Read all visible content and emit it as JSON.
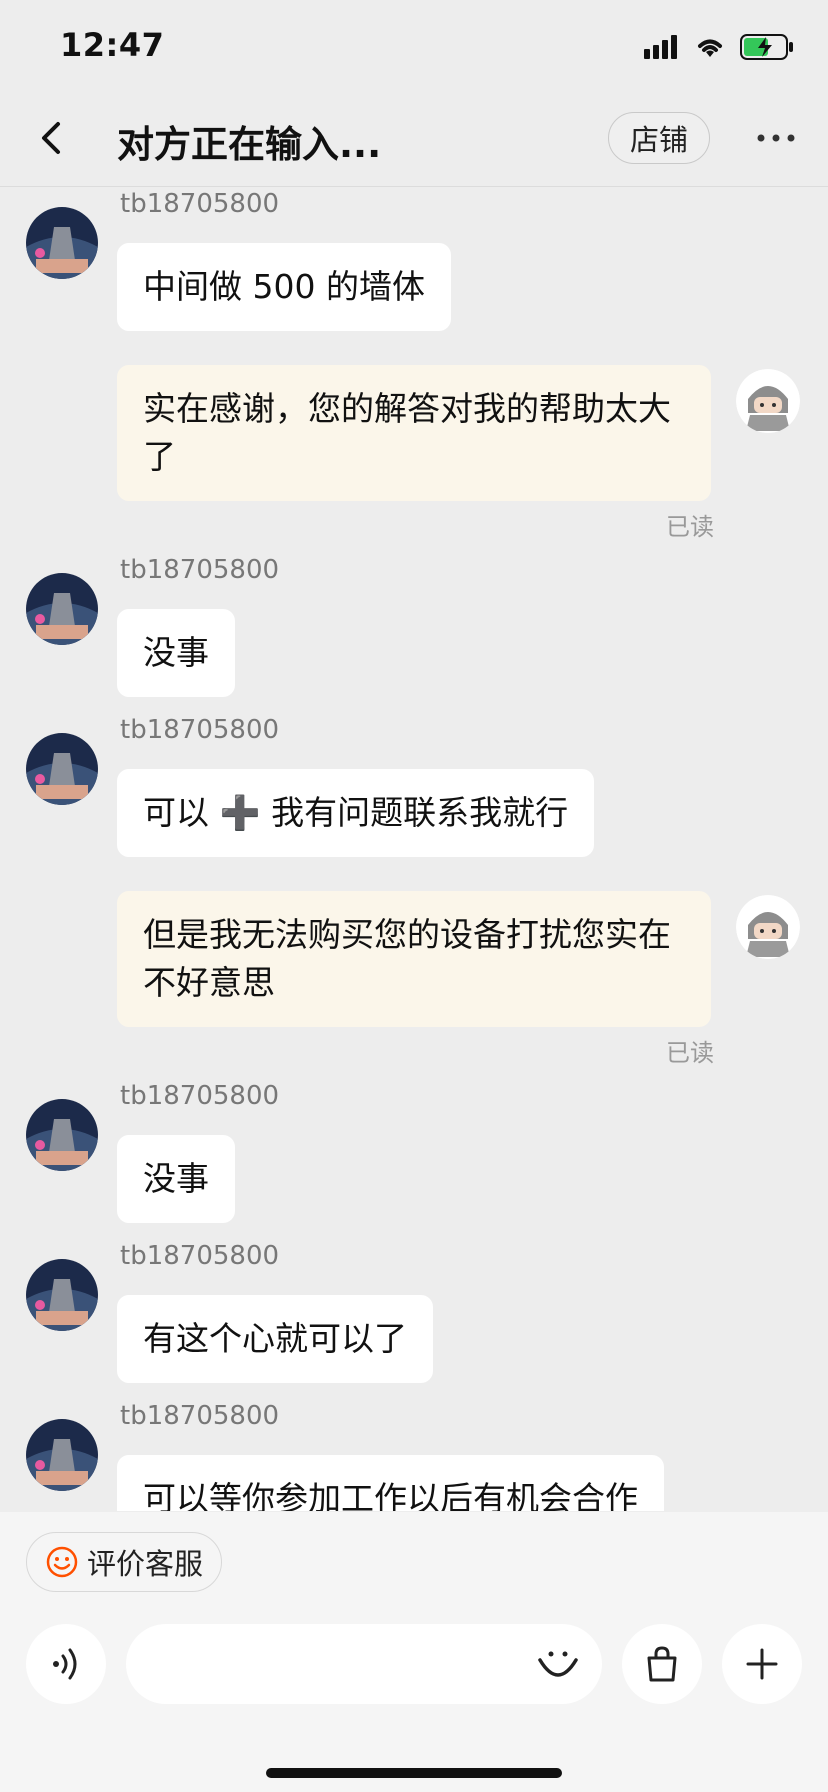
{
  "status_bar": {
    "time": "12:47"
  },
  "header": {
    "title": "对方正在输入...",
    "store_label": "店铺"
  },
  "messages": [
    {
      "side": "left",
      "sender": "tb18705800",
      "text": "中间做 500 的墙体"
    },
    {
      "side": "right",
      "text": "实在感谢，您的解答对我的帮助太大了",
      "status": "已读"
    },
    {
      "side": "left",
      "sender": "tb18705800",
      "text": "没事"
    },
    {
      "side": "left",
      "sender": "tb18705800",
      "text": "可以 ➕ 我有问题联系我就行"
    },
    {
      "side": "right",
      "text": "但是我无法购买您的设备打扰您实在不好意思",
      "status": "已读"
    },
    {
      "side": "left",
      "sender": "tb18705800",
      "text": "没事"
    },
    {
      "side": "left",
      "sender": "tb18705800",
      "text": "有这个心就可以了"
    },
    {
      "side": "left",
      "sender": "tb18705800",
      "text": "可以等你参加工作以后有机会合作"
    }
  ],
  "bottom": {
    "review_label": "评价客服"
  },
  "colors": {
    "self_bubble": "#fbf6ea",
    "other_bubble": "#ffffff",
    "accent": "#ff5000"
  }
}
